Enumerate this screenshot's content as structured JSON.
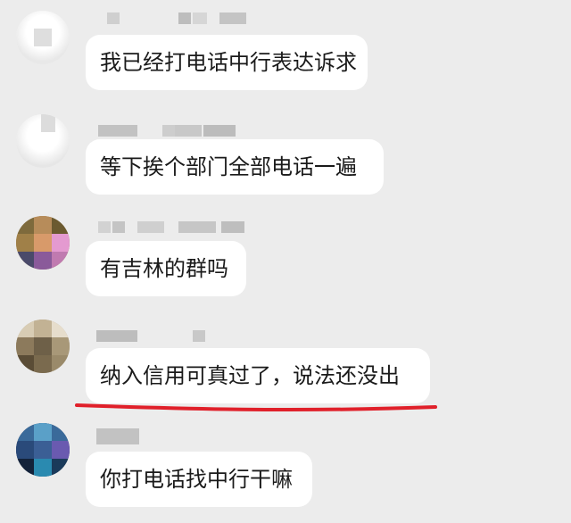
{
  "messages": [
    {
      "id": "m1",
      "sender_hidden": true,
      "text": "我已经打电话中行表达诉求"
    },
    {
      "id": "m2",
      "sender_hidden": true,
      "text": "等下挨个部门全部电话一遍"
    },
    {
      "id": "m3",
      "sender_hidden": true,
      "text": "有吉林的群吗"
    },
    {
      "id": "m4",
      "sender_hidden": true,
      "text": "纳入信用可真过了，说法还没出",
      "highlighted": true
    },
    {
      "id": "m5",
      "sender_hidden": true,
      "text": "你打电话找中行干嘛"
    }
  ],
  "colors": {
    "background": "#ececec",
    "bubble": "#ffffff",
    "underline": "#e0202a",
    "text": "#1a1a1a"
  }
}
